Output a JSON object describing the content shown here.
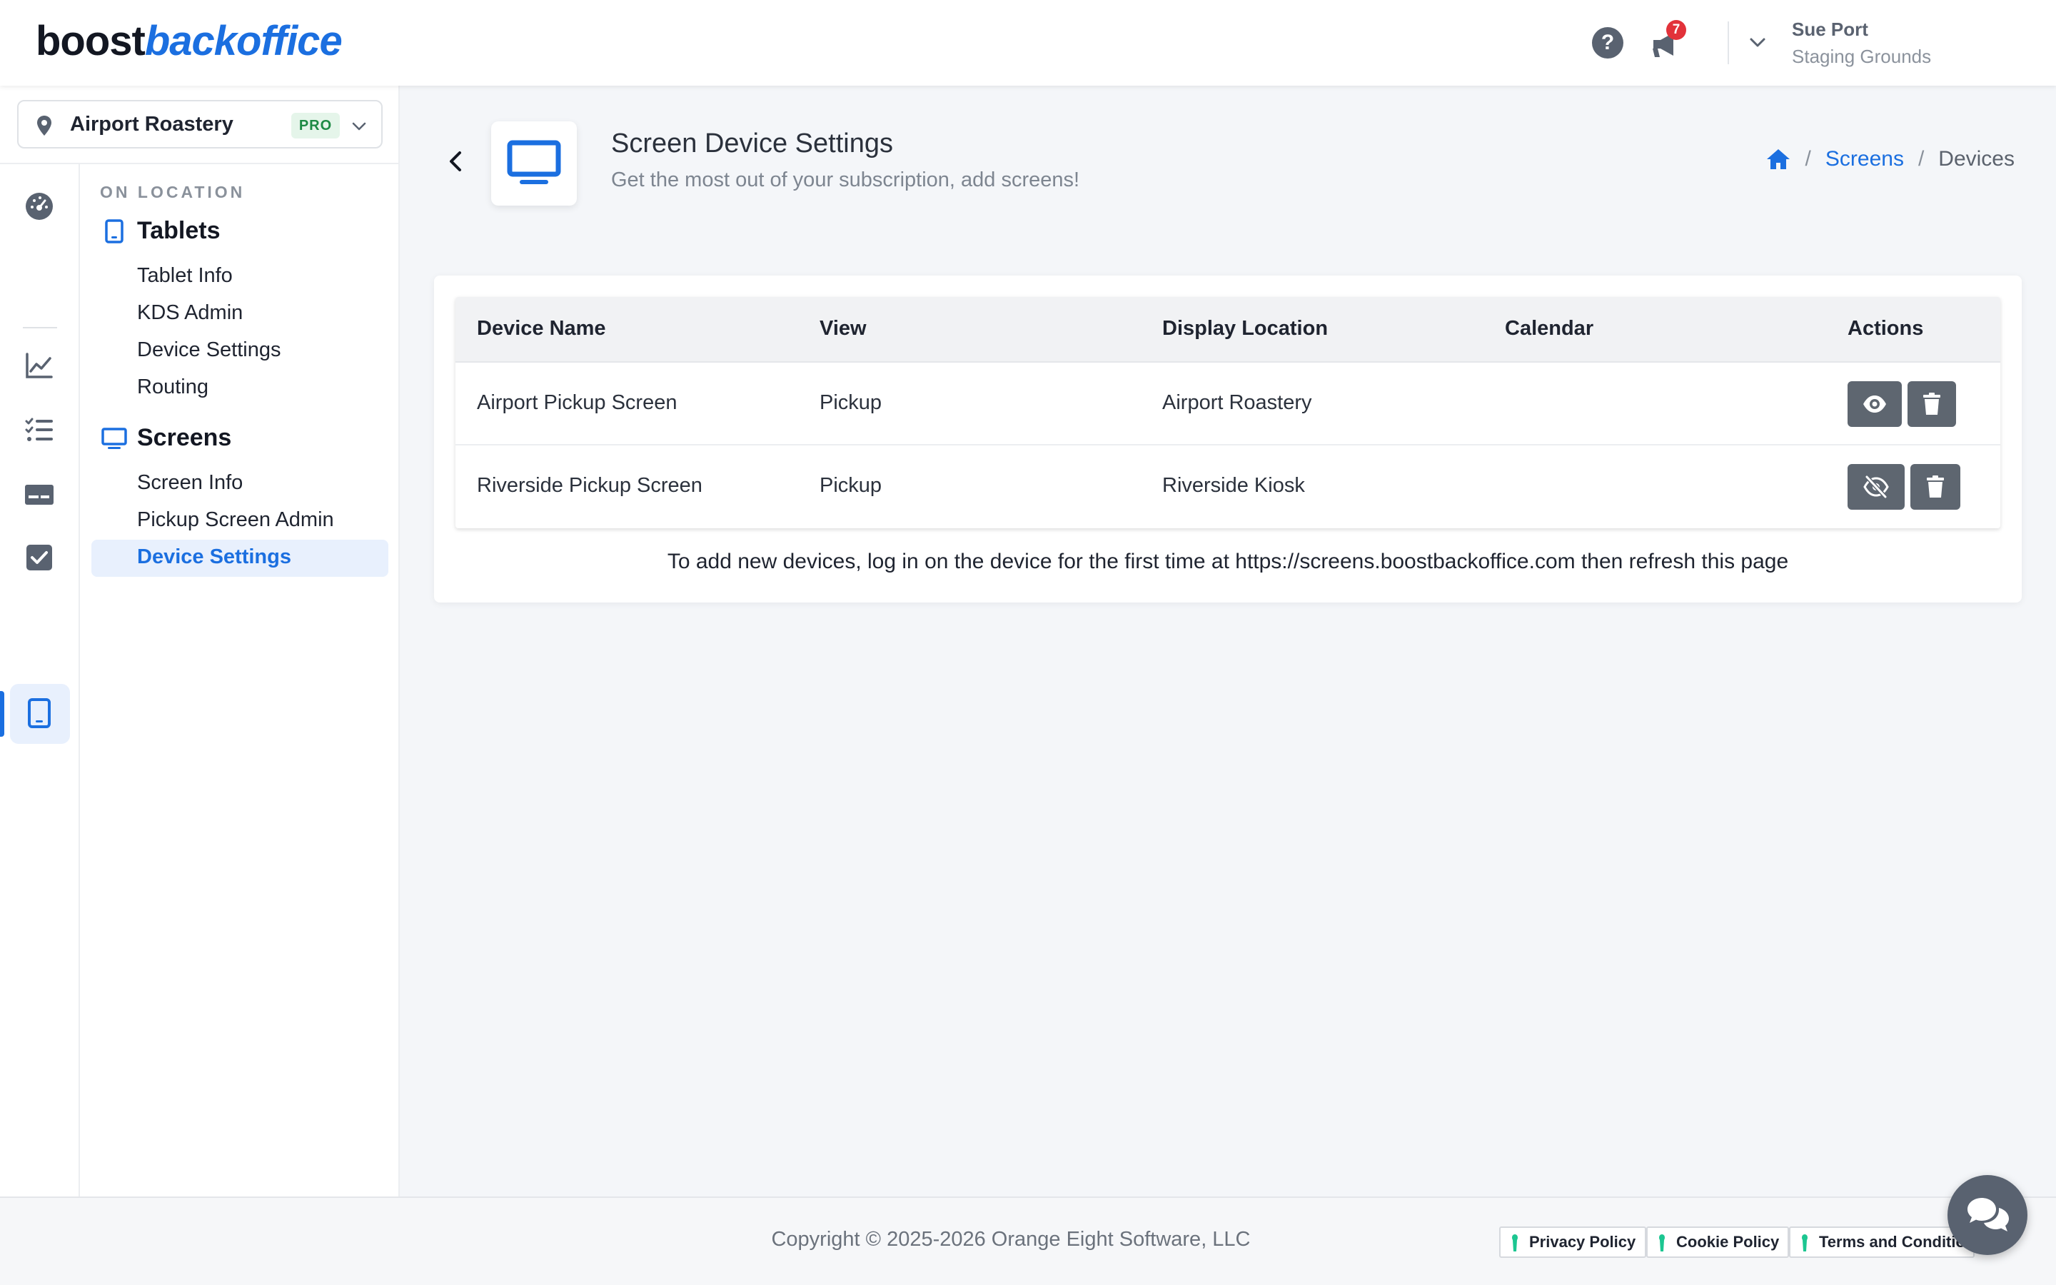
{
  "brand": {
    "logo_part1": "boost",
    "logo_part2": "backoffice",
    "accent_color": "#1b6fe0"
  },
  "header": {
    "help_icon": "question-circle-icon",
    "notifications_icon": "megaphone-icon",
    "notification_count": "7",
    "user_name": "Sue Port",
    "user_org": "Staging Grounds"
  },
  "location": {
    "name": "Airport Roastery",
    "plan_badge": "PRO"
  },
  "rail": {
    "icons": [
      "dashboard-gauge-icon",
      "chart-line-icon",
      "task-list-icon",
      "display-card-icon",
      "checkbox-icon",
      "tablet-icon"
    ],
    "active": "tablet-icon"
  },
  "nav": {
    "section_label": "ON LOCATION",
    "groups": [
      {
        "label": "Tablets",
        "icon": "tablet-icon",
        "items": [
          "Tablet Info",
          "KDS Admin",
          "Device Settings",
          "Routing"
        ]
      },
      {
        "label": "Screens",
        "icon": "monitor-icon",
        "items": [
          "Screen Info",
          "Pickup Screen Admin",
          "Device Settings"
        ]
      }
    ],
    "active_item": "Device Settings"
  },
  "page": {
    "title": "Screen Device Settings",
    "subtitle": "Get the most out of your subscription, add screens!",
    "breadcrumb": {
      "home_icon": "home-icon",
      "section": "Screens",
      "current": "Devices"
    }
  },
  "table": {
    "headers": [
      "Device Name",
      "View",
      "Display Location",
      "Calendar",
      "Actions"
    ],
    "rows": [
      {
        "name": "Airport Pickup Screen",
        "view": "Pickup",
        "location": "Airport Roastery",
        "calendar": "",
        "visibility_icon": "eye-icon"
      },
      {
        "name": "Riverside Pickup Screen",
        "view": "Pickup",
        "location": "Riverside Kiosk",
        "calendar": "",
        "visibility_icon": "eye-slash-icon"
      }
    ],
    "footer_hint": "To add new devices, log in on the device for the first time at https://screens.boostbackoffice.com then refresh this page"
  },
  "footer": {
    "copyright": "Copyright © 2025-2026 Orange Eight Software, LLC",
    "links": [
      "Privacy Policy",
      "Cookie Policy",
      "Terms and Conditions"
    ]
  }
}
